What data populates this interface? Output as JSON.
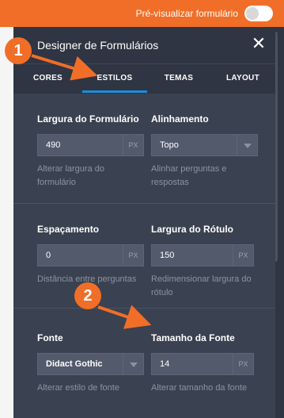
{
  "topbar": {
    "preview_label": "Pré-visualizar formulário",
    "toggle_on": false,
    "accent_color": "#f06e27"
  },
  "panel": {
    "title": "Designer de Formulários",
    "close_icon": "close-icon"
  },
  "tabs": [
    {
      "label": "CORES",
      "active": false
    },
    {
      "label": "ESTILOS",
      "active": true
    },
    {
      "label": "TEMAS",
      "active": false
    },
    {
      "label": "LAYOUT",
      "active": false
    }
  ],
  "fields": {
    "form_width": {
      "label": "Largura do Formulário",
      "value": "490",
      "unit": "PX",
      "helper": "Alterar largura do formulário"
    },
    "alignment": {
      "label": "Alinhamento",
      "value": "Topo",
      "helper": "Alinhar perguntas e respostas"
    },
    "spacing": {
      "label": "Espaçamento",
      "value": "0",
      "unit": "PX",
      "helper": "Distância entre perguntas"
    },
    "label_width": {
      "label": "Largura do Rótulo",
      "value": "150",
      "unit": "PX",
      "helper": "Redimensionar largura do rótulo"
    },
    "font": {
      "label": "Fonte",
      "value": "Didact Gothic",
      "helper": "Alterar estilo de fonte"
    },
    "font_size": {
      "label": "Tamanho da Fonte",
      "value": "14",
      "unit": "PX",
      "helper": "Alterar tamanho da fonte"
    }
  },
  "annotations": {
    "badge_1": "1",
    "badge_2": "2"
  }
}
